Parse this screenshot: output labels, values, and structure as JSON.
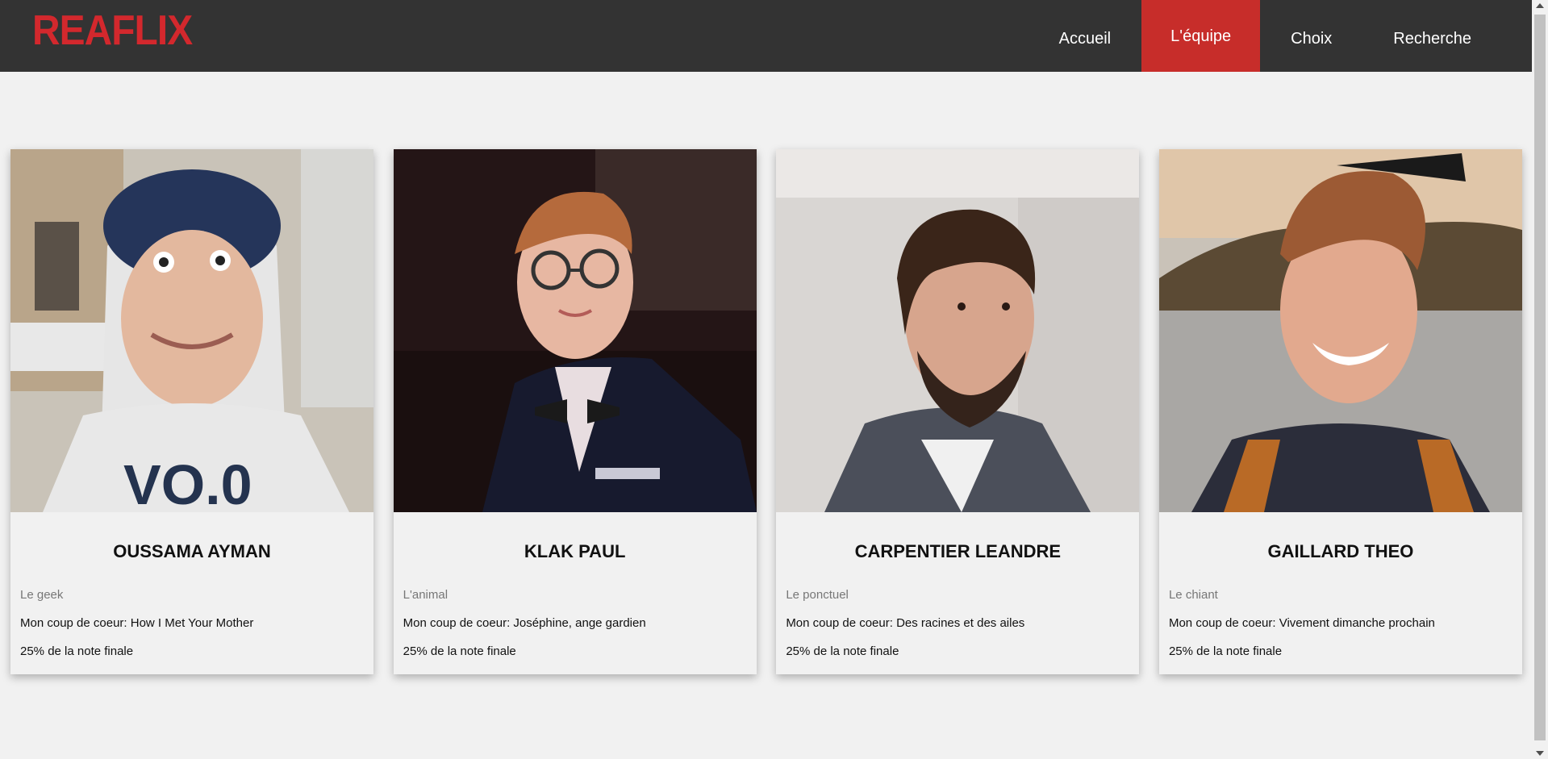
{
  "brand": {
    "logo_text": "REAFLIX",
    "color": "#d3282d"
  },
  "nav": {
    "items": [
      {
        "label": "Accueil",
        "active": false
      },
      {
        "label": "L'équipe",
        "active": true
      },
      {
        "label": "Choix",
        "active": false
      },
      {
        "label": "Recherche",
        "active": false
      }
    ],
    "active_color": "#c72d2a",
    "background": "#333333"
  },
  "team": [
    {
      "name": "OUSSAMA AYMAN",
      "role": "Le geek",
      "favorite": "Mon coup de coeur: How I Met Your Mother",
      "weight": "25% de la note finale",
      "photo_icon": "person-photo-hoodie"
    },
    {
      "name": "KLAK PAUL",
      "role": "L'animal",
      "favorite": "Mon coup de coeur: Joséphine, ange gardien",
      "weight": "25% de la note finale",
      "photo_icon": "person-photo-suit"
    },
    {
      "name": "CARPENTIER LEANDRE",
      "role": "Le ponctuel",
      "favorite": "Mon coup de coeur: Des racines et des ailes",
      "weight": "25% de la note finale",
      "photo_icon": "person-photo-beard"
    },
    {
      "name": "GAILLARD THEO",
      "role": "Le chiant",
      "favorite": "Mon coup de coeur: Vivement dimanche prochain",
      "weight": "25% de la note finale",
      "photo_icon": "person-photo-lake"
    }
  ]
}
